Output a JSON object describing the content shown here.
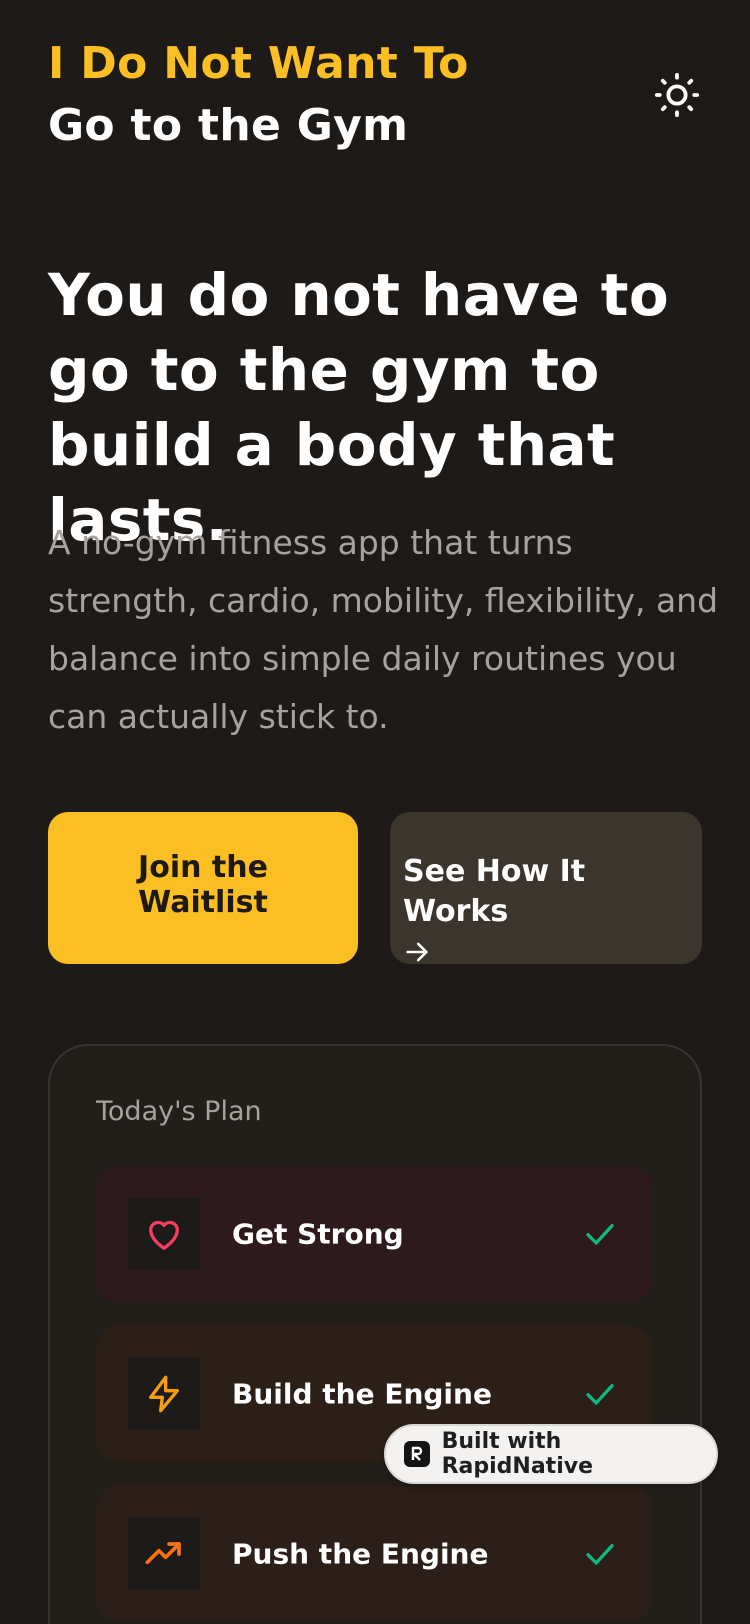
{
  "header": {
    "brand_line1": "I Do Not Want To",
    "brand_line2": "Go to the Gym",
    "theme_toggle_icon": "sun-icon"
  },
  "hero": {
    "headline": "You do not have to go to the gym to build a body that lasts.",
    "subtext": "A no-gym fitness app that turns strength, cardio, mobility, flexibility, and balance into simple daily routines you can actually stick to."
  },
  "buttons": {
    "primary_label": "Join the Waitlist",
    "secondary_label": "See How It Works",
    "secondary_icon": "arrow-right-icon"
  },
  "plan": {
    "title": "Today's Plan",
    "items": [
      {
        "label": "Get Strong",
        "icon": "heart-icon",
        "icon_color": "#f43f5e",
        "bg": "#2e1a1d",
        "done": true
      },
      {
        "label": "Build the Engine",
        "icon": "lightning-icon",
        "icon_color": "#f59e0b",
        "bg": "#2c1f18",
        "done": true
      },
      {
        "label": "Push the Engine",
        "icon": "trending-up-icon",
        "icon_color": "#f97316",
        "bg": "#2c1e18",
        "done": true
      }
    ]
  },
  "badge": {
    "text": "Built with RapidNative"
  },
  "colors": {
    "background": "#1e1a17",
    "accent": "#fbbf24",
    "check": "#10b981"
  }
}
